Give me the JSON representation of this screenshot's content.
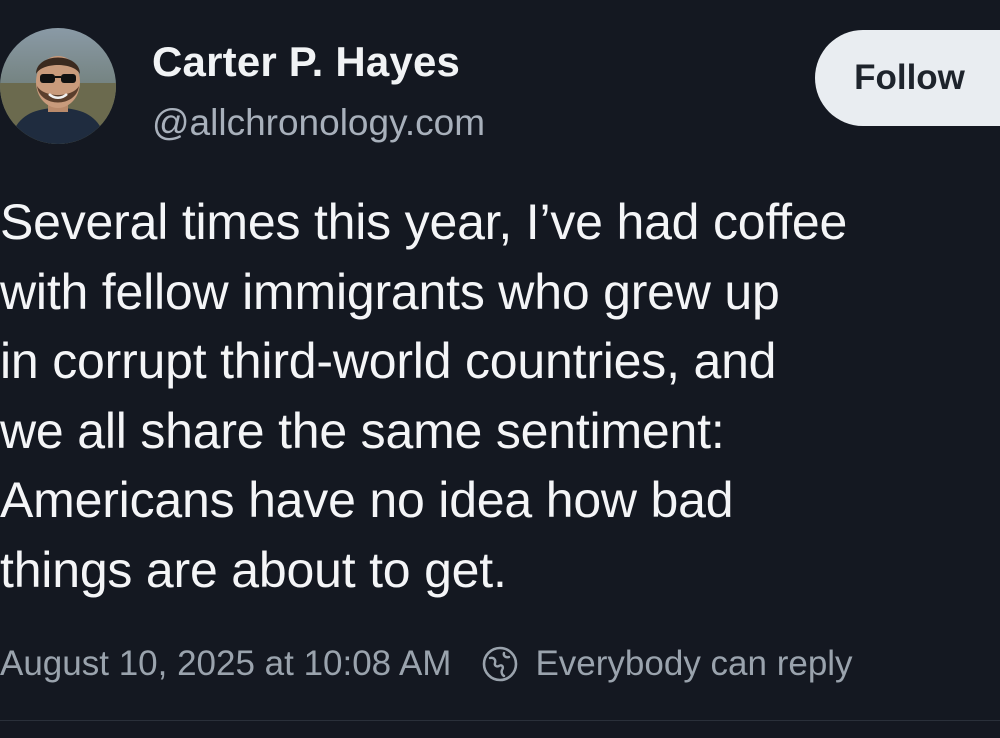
{
  "author": {
    "name": "Carter P. Hayes",
    "handle": "@allchronology.com"
  },
  "follow_label": "Follow",
  "post": {
    "lines": [
      "Several times this year, I’ve had coffee",
      "with fellow immigrants who grew up",
      "in corrupt third-world countries, and",
      "we all share the same sentiment:",
      "Americans have no idea how bad",
      "things are about to get."
    ],
    "timestamp": "August 10, 2025 at 10:08 AM",
    "reply_setting": "Everybody can reply",
    "reply_icon": "globe-icon"
  },
  "colors": {
    "background": "#141821",
    "follow_button": "#e9edf1",
    "muted_text": "#9aa3ad"
  }
}
